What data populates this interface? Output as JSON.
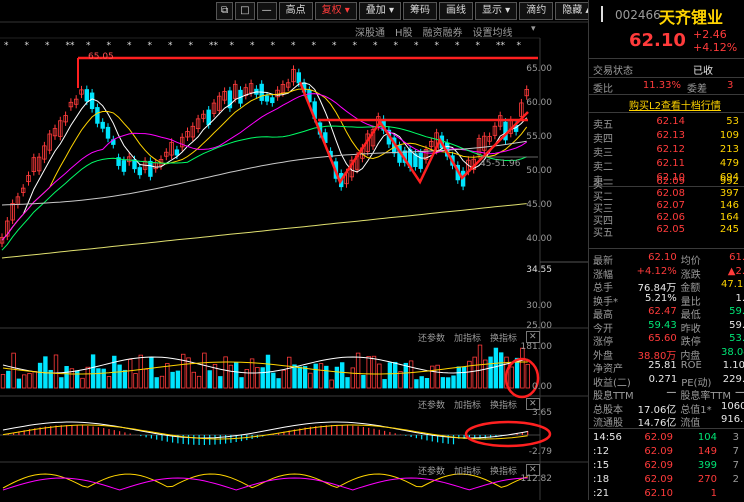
{
  "toolbar": {
    "buttons": [
      "高点",
      "复权",
      "叠加",
      "筹码",
      "画线",
      "显示",
      "滴约",
      "隐藏"
    ],
    "icon_names": [
      "restore-icon",
      "min-window-icon",
      "collapse-icon",
      "plus-icon",
      "minus-icon"
    ],
    "window_controls": [
      "▲",
      "▼",
      "✕"
    ]
  },
  "subbar": {
    "items": [
      "深股通",
      "H股",
      "融资融券",
      "设置均线"
    ]
  },
  "price_axis": [
    "65.00",
    "60.00",
    "55.00",
    "50.00",
    "45.00",
    "40.00",
    "34.55",
    "30.00",
    "25.00"
  ],
  "annotations": {
    "high_label": "65.05",
    "low_label": "45-51.96"
  },
  "volume": {
    "tools": [
      "还参数",
      "加指标",
      "换指标"
    ],
    "axis": [
      "181.00",
      "0.00"
    ]
  },
  "macd": {
    "tools": [
      "还参数",
      "加指标",
      "换指标"
    ],
    "axis": [
      "3.65",
      "-2.79"
    ]
  },
  "third": {
    "tools": [
      "还参数",
      "加指标",
      "换指标"
    ],
    "axis": [
      "112.82"
    ]
  },
  "stock": {
    "code": "002466",
    "name": "天齐锂业",
    "price": "62.10",
    "change": "+2.46",
    "pct": "+4.12%"
  },
  "panel": {
    "status_label": "交易状态",
    "status_value": "已收",
    "ratio_label": "委比",
    "ratio_value": "11.33%",
    "diff_label": "委差",
    "diff_value": "3",
    "l2_link": "购买L2查看十档行情"
  },
  "order_book": {
    "asks": [
      {
        "label": "卖五",
        "price": "62.14",
        "vol": "53"
      },
      {
        "label": "卖四",
        "price": "62.13",
        "vol": "109"
      },
      {
        "label": "卖三",
        "price": "62.12",
        "vol": "213"
      },
      {
        "label": "卖二",
        "price": "62.11",
        "vol": "479"
      },
      {
        "label": "卖一",
        "price": "62.10",
        "vol": "694"
      }
    ],
    "bids": [
      {
        "label": "买一",
        "price": "62.09",
        "vol": "992"
      },
      {
        "label": "买二",
        "price": "62.08",
        "vol": "397"
      },
      {
        "label": "买三",
        "price": "62.07",
        "vol": "146"
      },
      {
        "label": "买四",
        "price": "62.06",
        "vol": "164"
      },
      {
        "label": "买五",
        "price": "62.05",
        "vol": "245"
      }
    ]
  },
  "quotes": [
    {
      "l1": "最新",
      "v1": "62.10",
      "c1": "red",
      "l2": "均价",
      "v2": "61.",
      "c2": "red"
    },
    {
      "l1": "涨幅",
      "v1": "+4.12%",
      "c1": "red",
      "l2": "涨跌",
      "v2": "▲2.",
      "c2": "red"
    },
    {
      "l1": "总手",
      "v1": "76.84万",
      "c1": "white",
      "l2": "金额",
      "v2": "47.18",
      "c2": "yellow"
    },
    {
      "l1": "换手*",
      "v1": "5.21%",
      "c1": "white",
      "l2": "量比",
      "v2": "1.",
      "c2": "white"
    },
    {
      "l1": "最高",
      "v1": "62.47",
      "c1": "red",
      "l2": "最低",
      "v2": "59.",
      "c2": "green"
    },
    {
      "l1": "今开",
      "v1": "59.43",
      "c1": "green",
      "l2": "昨收",
      "v2": "59.",
      "c2": "white"
    },
    {
      "l1": "涨停",
      "v1": "65.60",
      "c1": "red",
      "l2": "跌停",
      "v2": "53.",
      "c2": "green"
    },
    {
      "l1": "外盘",
      "v1": "38.80万",
      "c1": "red",
      "l2": "内盘",
      "v2": "38.04",
      "c2": "green"
    },
    {
      "l1": "净资产",
      "v1": "25.81",
      "c1": "white",
      "l2": "ROE",
      "v2": "1.10",
      "c2": "white"
    },
    {
      "l1": "收益(二)",
      "v1": "0.271",
      "c1": "white",
      "l2": "PE(动)",
      "v2": "229.",
      "c2": "white"
    },
    {
      "l1": "股息TTM",
      "v1": "—",
      "c1": "white",
      "l2": "股息率TTM",
      "v2": "—",
      "c2": "white"
    },
    {
      "l1": "总股本",
      "v1": "17.06亿",
      "c1": "white",
      "l2": "总值1*",
      "v2": "1060",
      "c2": "white"
    },
    {
      "l1": "流通股",
      "v1": "14.76亿",
      "c1": "white",
      "l2": "流值",
      "v2": "916.3",
      "c2": "white"
    }
  ],
  "ticks": [
    {
      "time": "14:56",
      "price": "62.09",
      "vol": "104",
      "n": "3",
      "pc": "red",
      "vc": "green"
    },
    {
      "time": ":12",
      "price": "62.09",
      "vol": "149",
      "n": "7",
      "pc": "red",
      "vc": "red"
    },
    {
      "time": ":15",
      "price": "62.09",
      "vol": "399",
      "n": "7",
      "pc": "red",
      "vc": "green"
    },
    {
      "time": ":18",
      "price": "62.09",
      "vol": "270",
      "n": "2",
      "pc": "red",
      "vc": "red"
    },
    {
      "time": ":21",
      "price": "62.10",
      "vol": "1",
      "n": "",
      "pc": "red",
      "vc": "red"
    }
  ],
  "colors": {
    "up": "#ff3b3b",
    "down": "#00e5ff",
    "ma5": "#ffffff",
    "ma10": "#ffd400",
    "ma20": "#ff00ff",
    "ma60": "#00ff66",
    "ma120": "#c8c8c8",
    "ma250": "#e0e070",
    "annotation": "#ff2020"
  }
}
